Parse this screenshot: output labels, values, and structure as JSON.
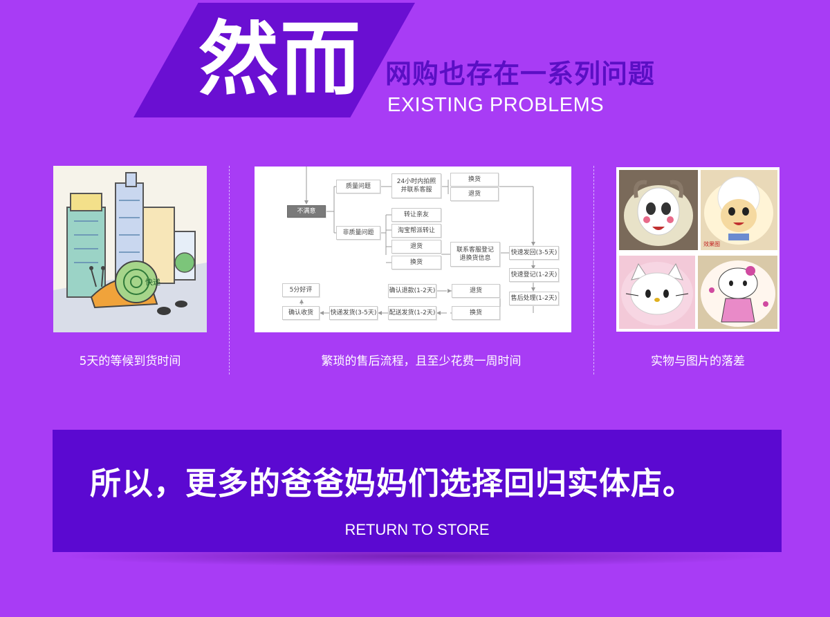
{
  "header": {
    "big_title": "然而",
    "subtitle_cn": "网购也存在一系列问题",
    "subtitle_en": "EXISTING PROBLEMS"
  },
  "problems": [
    {
      "caption": "5天的等候到货时间",
      "image_text": "快递"
    },
    {
      "caption": "繁琐的售后流程，且至少花费一周时间"
    },
    {
      "caption": "实物与图片的落差"
    }
  ],
  "flowchart": {
    "start": "不满意",
    "quality": "质量问题",
    "non_quality": "非质量问题",
    "photo_contact": "24小时内拍照\n并联系客服",
    "exchange": "换货",
    "return": "退货",
    "transfer_friend": "转让亲友",
    "taobao_transfer": "淘宝帮派转让",
    "return2": "退货",
    "exchange2": "换货",
    "contact_register": "联系客服登记\n退换货信息",
    "express_back": "快速发回(3-5天)",
    "express_register": "快速登记(1-2天)",
    "after_sale": "售后处理(1-2天)",
    "return3": "退货",
    "exchange3": "换货",
    "refund": "确认退款(1-2天)",
    "delivery": "配送发货(1-2天)",
    "express_ship": "快递发货(3-5天)",
    "confirm_receive": "确认收货",
    "good_review": "5分好评"
  },
  "cake_watermark": "效果图",
  "panel": {
    "title": "所以，更多的爸爸妈妈们选择回归实体店。",
    "subtitle": "RETURN TO STORE"
  },
  "colors": {
    "background": "#a83cf5",
    "banner": "#6a0fd2",
    "panel": "#5b09d1",
    "subtitle_cn": "#5a0fc4"
  }
}
